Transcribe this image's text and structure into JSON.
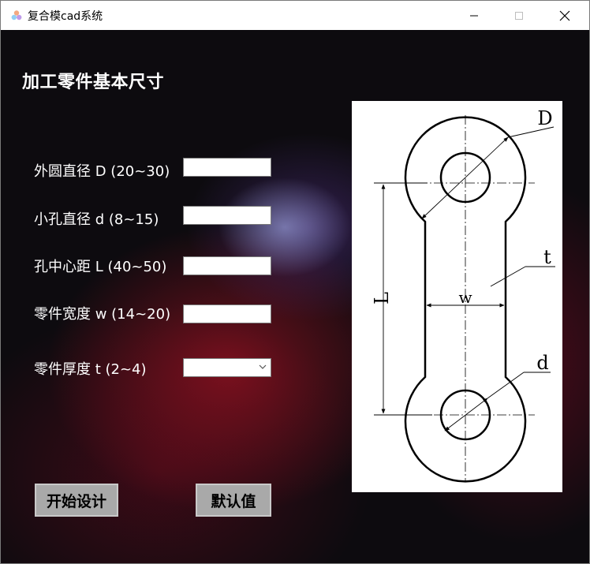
{
  "window": {
    "title": "复合模cad系统"
  },
  "heading": "加工零件基本尺寸",
  "fields": [
    {
      "label": "外圆直径 D (20~30)",
      "value": ""
    },
    {
      "label": "小孔直径 d (8~15)",
      "value": ""
    },
    {
      "label": "孔中心距 L (40~50)",
      "value": ""
    },
    {
      "label": "零件宽度 w (14~20)",
      "value": ""
    },
    {
      "label": "零件厚度 t (2~4)",
      "value": ""
    }
  ],
  "figure": {
    "label_D": "D",
    "label_t": "t",
    "label_L": "L",
    "label_w": "w",
    "label_d": "d"
  },
  "buttons": {
    "start": "开始设计",
    "default": "默认值"
  },
  "colors": {
    "button_bg": "#a9a9a9",
    "titlebar_bg": "#ffffff"
  }
}
